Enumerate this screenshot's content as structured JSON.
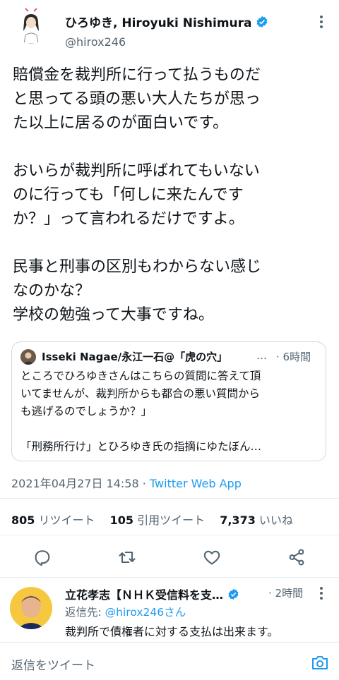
{
  "tweet": {
    "author_name": "ひろゆき, Hiroyuki Nishimura",
    "handle": "@hirox246",
    "paragraphs": [
      "賠償金を裁判所に行って払うものだ\nと思ってる頭の悪い大人たちが思っ\nた以上に居るのが面白いです。",
      "おいらが裁判所に呼ばれてもいない\nのに行っても「何しに来たんです\nか？」って言われるだけですよ。",
      "民事と刑事の区別もわからない感じ\nなのかな？\n学校の勉強って大事ですね。"
    ],
    "timestamp": "2021年04月27日 14:58 · ",
    "source": "Twitter Web App"
  },
  "quote": {
    "author": "Isseki Nagae/永江一石@「虎の穴」",
    "ellipsis": "…",
    "time": "· 6時間",
    "text": "ところでひろゆきさんはこちらの質問に答えて頂\nいてませんが、裁判所からも都合の悪い質問から\nも逃げるのでしょうか？」",
    "text2": "「刑務所行け」とひろゆき氏の指摘にゆたぼん…"
  },
  "stats": {
    "retweets_count": "805",
    "retweets_label": "リツイート",
    "quotes_count": "105",
    "quotes_label": "引用ツイート",
    "likes_count": "7,373",
    "likes_label": "いいね"
  },
  "actions": [
    "reply-icon",
    "retweet-icon",
    "like-icon",
    "share-icon"
  ],
  "reply": {
    "author": "立花孝志【ＮＨＫ受信料を支…",
    "time": "· 2時間",
    "replying_label": "返信先: ",
    "replying_to": "@hirox246さん",
    "text": "裁判所で債権者に対する支払は出来ます。"
  },
  "compose": {
    "placeholder": "返信をツイート"
  },
  "colors": {
    "accent": "#1d9bf0",
    "secondary_text": "#536471",
    "border": "#cfd9de"
  }
}
